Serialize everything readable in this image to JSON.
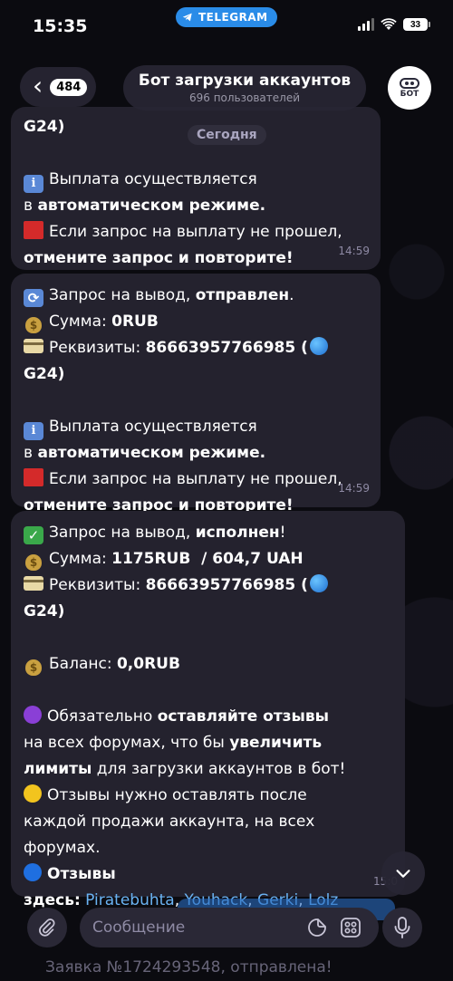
{
  "status_bar": {
    "time": "15:35",
    "pill_label": "TELEGRAM",
    "battery": "33"
  },
  "header": {
    "back_count": "484",
    "title": "Бот загрузки аккаунтов",
    "subtitle": "696 пользователей",
    "avatar_label": "БОТ"
  },
  "date_separator": "Сегодня",
  "messages": [
    {
      "partial_first_line": "G24)",
      "lines": [
        {
          "pre": "Выплата осуществляется",
          "bold": "",
          "post": ""
        },
        {
          "pre": "в ",
          "bold": "автоматическом режиме.",
          "post": ""
        },
        {
          "pre": "Если запрос на выплату не прошел,",
          "bold": "",
          "post": ""
        },
        {
          "pre": "",
          "bold": "отмените запрос и повторите!",
          "post": ""
        }
      ],
      "time": "14:59"
    },
    {
      "lines": [
        {
          "pre": "Запрос на вывод, ",
          "bold": "отправлен",
          "post": "."
        },
        {
          "pre": "Сумма: ",
          "bold": "0RUB",
          "post": ""
        },
        {
          "pre": "Реквизиты: ",
          "bold": "86663957766985 (",
          "post": ""
        },
        {
          "pre": "",
          "bold": "G24)",
          "post": ""
        },
        {
          "pre": "Выплата осуществляется",
          "bold": "",
          "post": ""
        },
        {
          "pre": "в ",
          "bold": "автоматическом режиме.",
          "post": ""
        },
        {
          "pre": "Если запрос на выплату не прошел,",
          "bold": "",
          "post": ""
        },
        {
          "pre": "",
          "bold": "отмените запрос и повторите!",
          "post": ""
        }
      ],
      "time": "14:59"
    },
    {
      "lines": [
        {
          "pre": "Запрос на вывод, ",
          "bold": "исполнен",
          "post": "!"
        },
        {
          "pre": "Сумма: ",
          "bold": "1175RUB  / 604,7 UAH",
          "post": ""
        },
        {
          "pre": "Реквизиты: ",
          "bold": "86663957766985 (",
          "post": ""
        },
        {
          "pre": "",
          "bold": "G24)",
          "post": ""
        },
        {
          "pre": "Баланс: ",
          "bold": "0,0RUB",
          "post": ""
        },
        {
          "pre": "Обязательно ",
          "bold": "оставляйте отзывы",
          "post": ""
        },
        {
          "pre": "на всех форумах, что бы ",
          "bold": "увеличить",
          "post": ""
        },
        {
          "pre": "",
          "bold": "лимиты",
          "post": " для загрузки аккаунтов в бот!"
        },
        {
          "pre": "Отзывы нужно оставлять после",
          "bold": "",
          "post": ""
        },
        {
          "pre": "каждой продажи аккаунта, на всех",
          "bold": "",
          "post": ""
        },
        {
          "pre": "форумах.",
          "bold": "",
          "post": ""
        },
        {
          "pre": "",
          "bold": "Отзывы",
          "post": ""
        },
        {
          "pre": "",
          "bold": "здесь:",
          "post": " "
        }
      ],
      "links": [
        "Piratebuhta",
        "Youhack",
        "Gerki",
        "Lolz"
      ],
      "time": "15:0"
    }
  ],
  "input": {
    "placeholder": "Сообщение"
  },
  "background_peek": {
    "text": "Заявка №1724293548, отправлена!"
  },
  "colors": {
    "bubble": "#24222e",
    "link": "#6ab3f3",
    "accent": "#2a8ce8"
  }
}
